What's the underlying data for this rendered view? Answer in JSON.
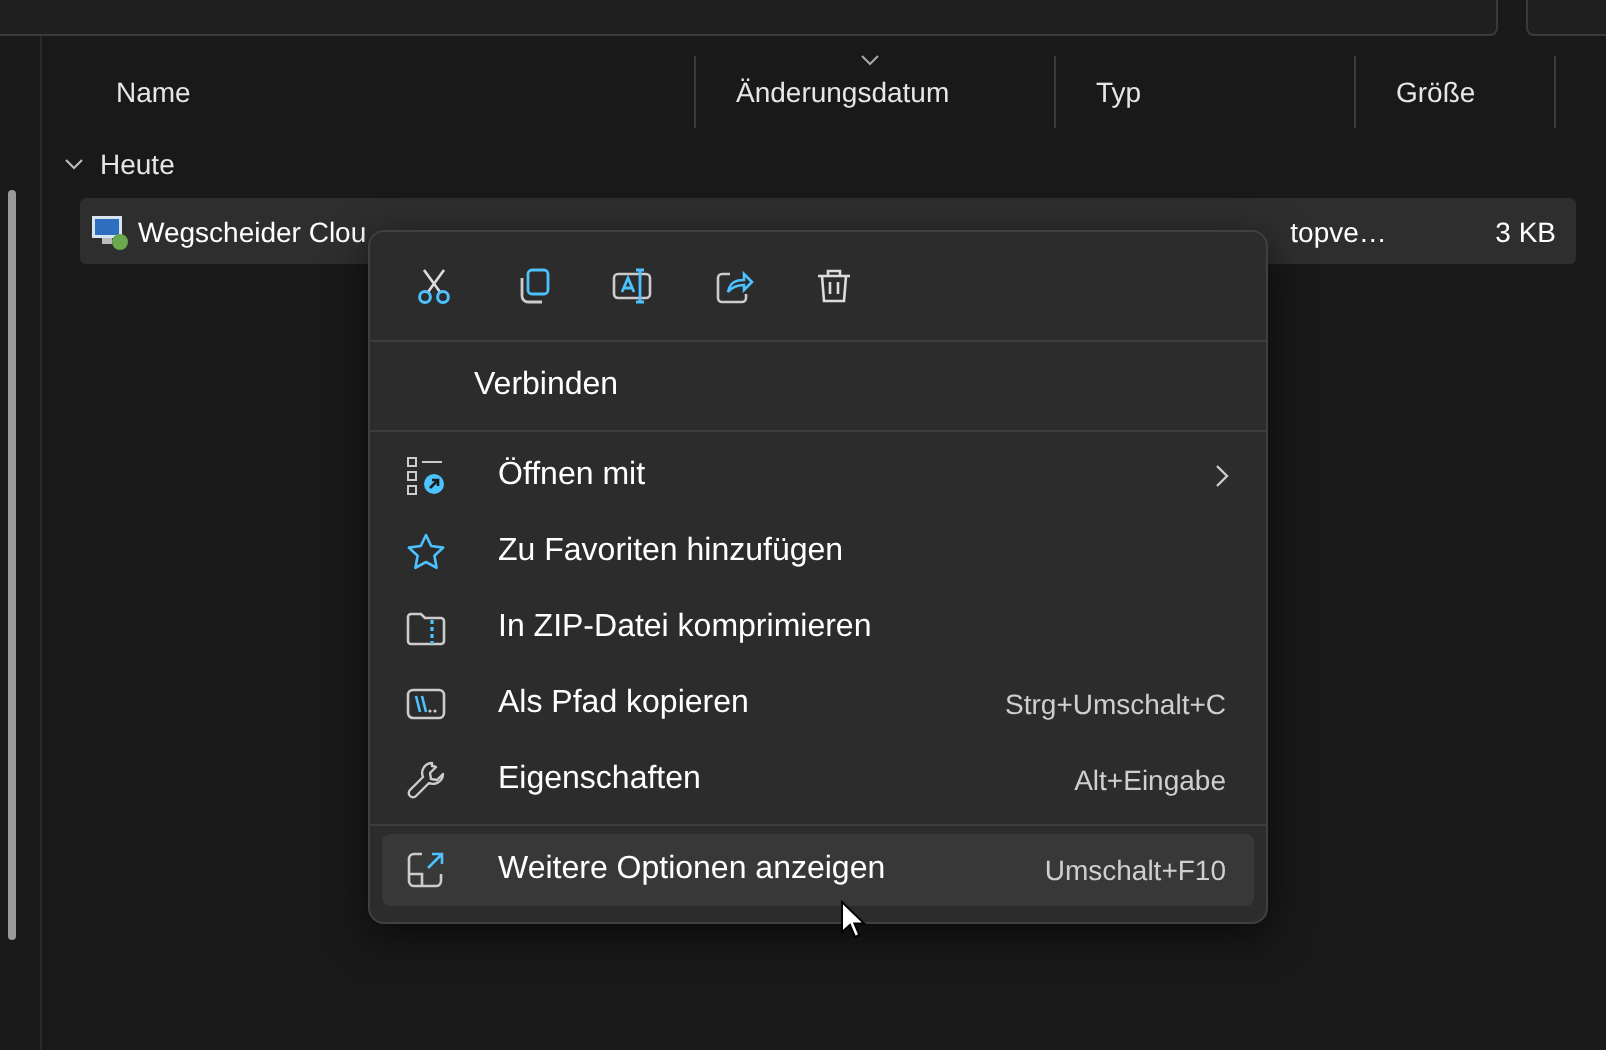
{
  "columns": [
    {
      "label": "Name",
      "sorted": false
    },
    {
      "label": "Änderungsdatum",
      "sorted": true
    },
    {
      "label": "Typ",
      "sorted": false
    },
    {
      "label": "Größe",
      "sorted": false
    }
  ],
  "group": {
    "label": "Heute",
    "expanded": true
  },
  "file": {
    "name": "Wegscheider Clou",
    "type": "topve…",
    "size": "3 KB",
    "selected": true
  },
  "context_menu": {
    "actions": [
      {
        "kind": "cut"
      },
      {
        "kind": "copy"
      },
      {
        "kind": "rename"
      },
      {
        "kind": "share"
      },
      {
        "kind": "delete"
      }
    ],
    "primary": "Verbinden",
    "items": [
      {
        "kind": "open-with",
        "label": "Öffnen mit",
        "submenu": true,
        "highlighted": false
      },
      {
        "kind": "favorite",
        "label": "Zu Favoriten hinzufügen",
        "submenu": false,
        "highlighted": false
      },
      {
        "kind": "zip",
        "label": "In ZIP-Datei komprimieren",
        "submenu": false,
        "highlighted": false
      },
      {
        "kind": "path",
        "label": "Als Pfad kopieren",
        "shortcut": "Strg+Umschalt+C",
        "submenu": false,
        "highlighted": false
      },
      {
        "kind": "properties",
        "label": "Eigenschaften",
        "shortcut": "Alt+Eingabe",
        "submenu": false,
        "highlighted": false
      },
      {
        "kind": "more",
        "label": "Weitere Optionen anzeigen",
        "shortcut": "Umschalt+F10",
        "submenu": false,
        "highlighted": true
      }
    ]
  }
}
